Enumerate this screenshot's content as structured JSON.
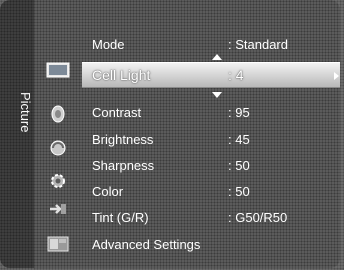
{
  "sidebar": {
    "label": "Picture",
    "icons": [
      {
        "name": "picture-icon",
        "active": true
      },
      {
        "name": "sound-icon"
      },
      {
        "name": "channel-icon"
      },
      {
        "name": "setup-icon"
      },
      {
        "name": "input-icon"
      },
      {
        "name": "application-icon"
      }
    ]
  },
  "menu": {
    "items": [
      {
        "label": "Mode",
        "value": ": Standard"
      },
      {
        "label": "Cell Light",
        "value": ": 4",
        "selected": true
      },
      {
        "label": "Contrast",
        "value": ": 95"
      },
      {
        "label": "Brightness",
        "value": ": 45"
      },
      {
        "label": "Sharpness",
        "value": ": 50"
      },
      {
        "label": "Color",
        "value": ": 50"
      },
      {
        "label": "Tint (G/R)",
        "value": ": G50/R50"
      },
      {
        "label": "Advanced Settings",
        "value": ""
      }
    ]
  },
  "colors": {
    "background": "#5c5c5c",
    "highlight": "#d8d8d8",
    "text": "#ffffff"
  }
}
